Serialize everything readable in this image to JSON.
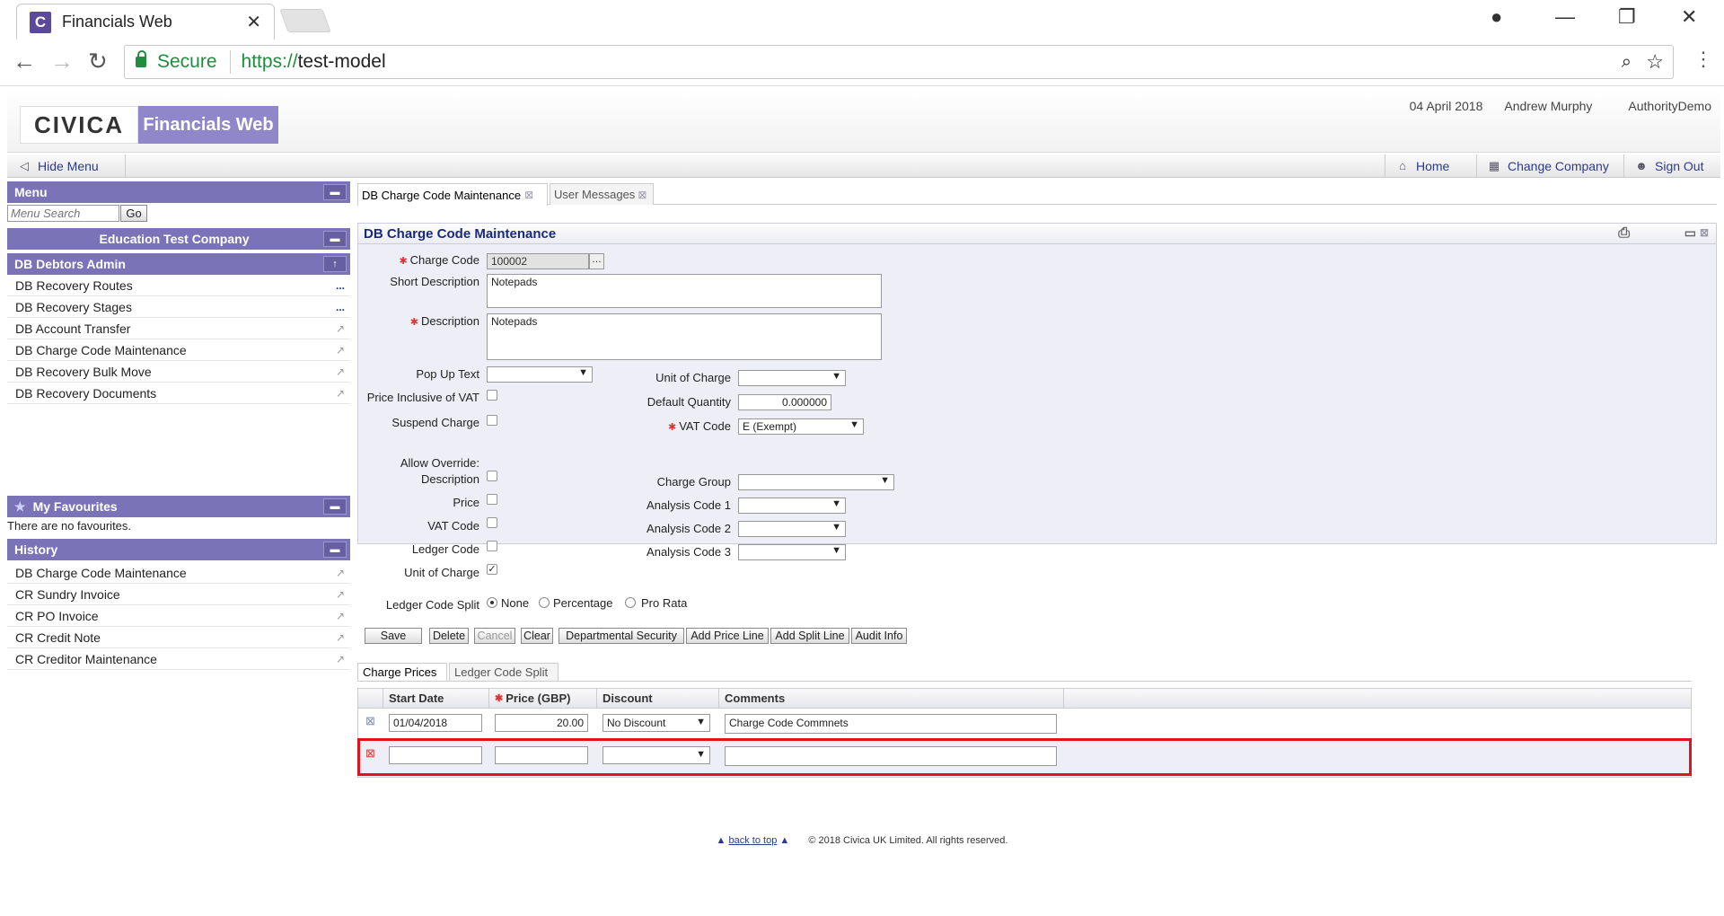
{
  "browser": {
    "tab_title": "Financials Web",
    "favicon_letter": "C",
    "secure_label": "Secure",
    "url_scheme": "https://",
    "url_host": "test-model"
  },
  "header": {
    "logo": "CIVICA",
    "product": "Financials Web",
    "date": "04 April 2018",
    "user": "Andrew Murphy",
    "authority": "AuthorityDemo"
  },
  "toolbar": {
    "hide_menu": "Hide Menu",
    "home": "Home",
    "change_company": "Change Company",
    "sign_out": "Sign Out"
  },
  "menu": {
    "title": "Menu",
    "search_placeholder": "Menu Search",
    "go": "Go",
    "company": "Education Test Company",
    "section": "DB Debtors Admin",
    "items": [
      {
        "label": "DB Recovery Routes",
        "more": "..."
      },
      {
        "label": "DB Recovery Stages",
        "more": "..."
      },
      {
        "label": "DB Account Transfer",
        "more": "↗"
      },
      {
        "label": "DB Charge Code Maintenance",
        "more": "↗"
      },
      {
        "label": "DB Recovery Bulk Move",
        "more": "↗"
      },
      {
        "label": "DB Recovery Documents",
        "more": "↗"
      }
    ]
  },
  "favourites": {
    "title": "My Favourites",
    "empty": "There are no favourites."
  },
  "history": {
    "title": "History",
    "items": [
      "DB Charge Code Maintenance",
      "CR Sundry Invoice",
      "CR PO Invoice",
      "CR Credit Note",
      "CR Creditor Maintenance"
    ]
  },
  "tabs": [
    {
      "label": "DB Charge Code Maintenance"
    },
    {
      "label": "User Messages"
    }
  ],
  "form": {
    "title": "DB Charge Code Maintenance",
    "charge_code_label": "Charge Code",
    "charge_code": "100002",
    "short_desc_label": "Short Description",
    "short_desc": "Notepads",
    "desc_label": "Description",
    "desc": "Notepads",
    "popup_label": "Pop Up Text",
    "price_incl_vat_label": "Price Inclusive of VAT",
    "suspend_label": "Suspend Charge",
    "allow_override_label": "Allow Override:",
    "ov_description": "Description",
    "ov_price": "Price",
    "ov_vat": "VAT Code",
    "ov_ledger": "Ledger Code",
    "ov_unit": "Unit of Charge",
    "split_label": "Ledger Code Split",
    "split_none": "None",
    "split_pct": "Percentage",
    "split_pro": "Pro Rata",
    "unit_label": "Unit of Charge",
    "qty_label": "Default Quantity",
    "qty": "0.000000",
    "vat_label": "VAT Code",
    "vat": "E (Exempt)",
    "group_label": "Charge Group",
    "an1_label": "Analysis Code 1",
    "an2_label": "Analysis Code 2",
    "an3_label": "Analysis Code 3"
  },
  "buttons": [
    "Save",
    "Delete",
    "Cancel",
    "Clear",
    "Departmental Security",
    "Add Price Line",
    "Add Split Line",
    "Audit Info"
  ],
  "grid_tabs": [
    "Charge Prices",
    "Ledger Code Split"
  ],
  "grid": {
    "headers": [
      "Start Date",
      "Price (GBP)",
      "Discount",
      "Comments"
    ],
    "rows": [
      {
        "start": "01/04/2018",
        "price": "20.00",
        "discount": "No Discount",
        "comments": "Charge Code Commnets"
      },
      {
        "start": "",
        "price": "",
        "discount": "",
        "comments": ""
      }
    ]
  },
  "footer": {
    "back_to_top": "back to top",
    "copyright": "© 2018 Civica UK Limited. All rights reserved."
  }
}
